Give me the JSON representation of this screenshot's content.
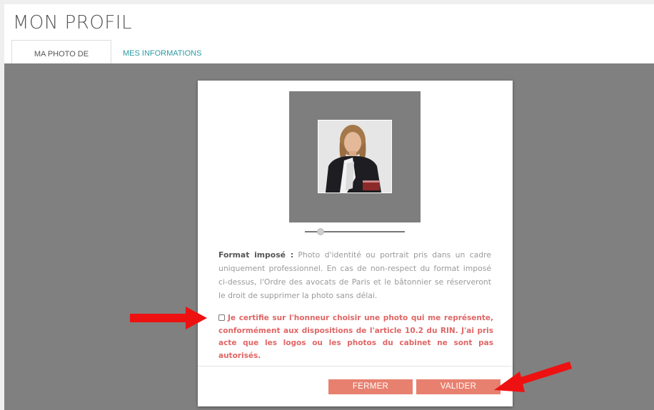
{
  "page": {
    "title": "MON PROFIL"
  },
  "tabs": [
    {
      "label": "MA PHOTO DE PROFIL",
      "active": true
    },
    {
      "label": "MES INFORMATIONS",
      "active": false
    }
  ],
  "modal": {
    "slider_value": 0.12,
    "format_label": "Format imposé :",
    "format_text": " Photo d'identité ou portrait pris dans un cadre uniquement professionnel. En cas de non-respect du format imposé ci-dessus, l'Ordre des avocats de Paris et le bâtonnier se réserveront le droit de supprimer la photo sans délai.",
    "certify_checked": false,
    "certify_text": "Je certifie sur l'honneur choisir une photo qui me représente, conformément aux dispositions de l'article 10.2 du RIN. J'ai pris acte que les logos ou les photos du cabinet ne sont pas autorisés.",
    "close_label": "FERMER",
    "validate_label": "VALIDER"
  },
  "colors": {
    "overlay": "#808080",
    "button": "#e8806f",
    "certify_text": "#e06666",
    "tab_link": "#2a9ba0",
    "annotation_arrow": "#ee1111"
  },
  "icons": [
    "photo-crop-preview",
    "slider-thumb",
    "checkbox",
    "red-arrow-annotation"
  ]
}
